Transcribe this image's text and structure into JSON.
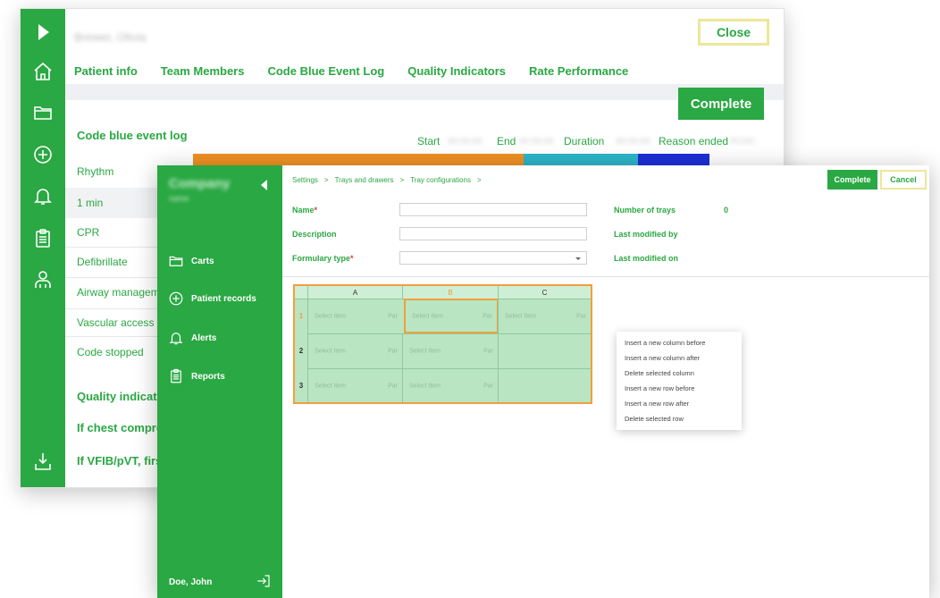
{
  "back_window": {
    "patient_name": "Brewer, Olivia",
    "close_label": "Close",
    "tabs": [
      "Patient info",
      "Team Members",
      "Code Blue Event Log",
      "Quality Indicators",
      "Rate Performance"
    ],
    "complete_label": "Complete",
    "event_log_title": "Code blue event log",
    "columns": {
      "start": "Start",
      "start_value": "00:00:00",
      "end": "End",
      "end_value": "00:00:00",
      "duration": "Duration",
      "duration_value": "00:00:00",
      "reason": "Reason ended",
      "reason_value": "ROSC"
    },
    "timeline_colors": [
      "#ef9124",
      "#2eb5c9",
      "#1d2fd8"
    ],
    "rows": [
      "Rhythm",
      "1 min",
      "CPR",
      "Defibrillate",
      "Airway management",
      "Vascular access",
      "Code stopped"
    ],
    "quality_indicators": "Quality indicat",
    "if_chest": "If chest compre",
    "if_vfib": "If VFIB/pVT, firs"
  },
  "front_window": {
    "company": "Company",
    "company_sub": "name",
    "sidebar_items": [
      "Carts",
      "Patient records",
      "Alerts",
      "Reports"
    ],
    "user": "Doe, John",
    "breadcrumb": [
      "Settings",
      "Trays and drawers",
      "Tray configurations"
    ],
    "breadcrumb_sep": ">",
    "complete_label": "Complete",
    "cancel_label": "Cancel",
    "form": {
      "name_label": "Name",
      "description_label": "Description",
      "formulary_label": "Formulary type",
      "required_mark": "*",
      "name_value": "",
      "description_value": "",
      "formulary_value": ""
    },
    "info": {
      "num_trays_label": "Number of trays",
      "num_trays_value": "0",
      "last_modified_by": "Last modified by",
      "last_modified_on": "Last modified on"
    },
    "grid": {
      "columns": [
        "A",
        "B",
        "C"
      ],
      "rows": [
        "1",
        "2",
        "3"
      ],
      "cell_item": "Select Item",
      "cell_par": "Par"
    },
    "context_menu": [
      "Insert a new column before",
      "Insert a new column after",
      "Delete selected column",
      "Insert a new row before",
      "Insert a new row after",
      "Delete selected row"
    ]
  },
  "colors": {
    "brand_green": "#2aa843",
    "highlight_yellow": "#ece79a",
    "selection_orange": "#f0a03c",
    "required_red": "#e53935"
  }
}
